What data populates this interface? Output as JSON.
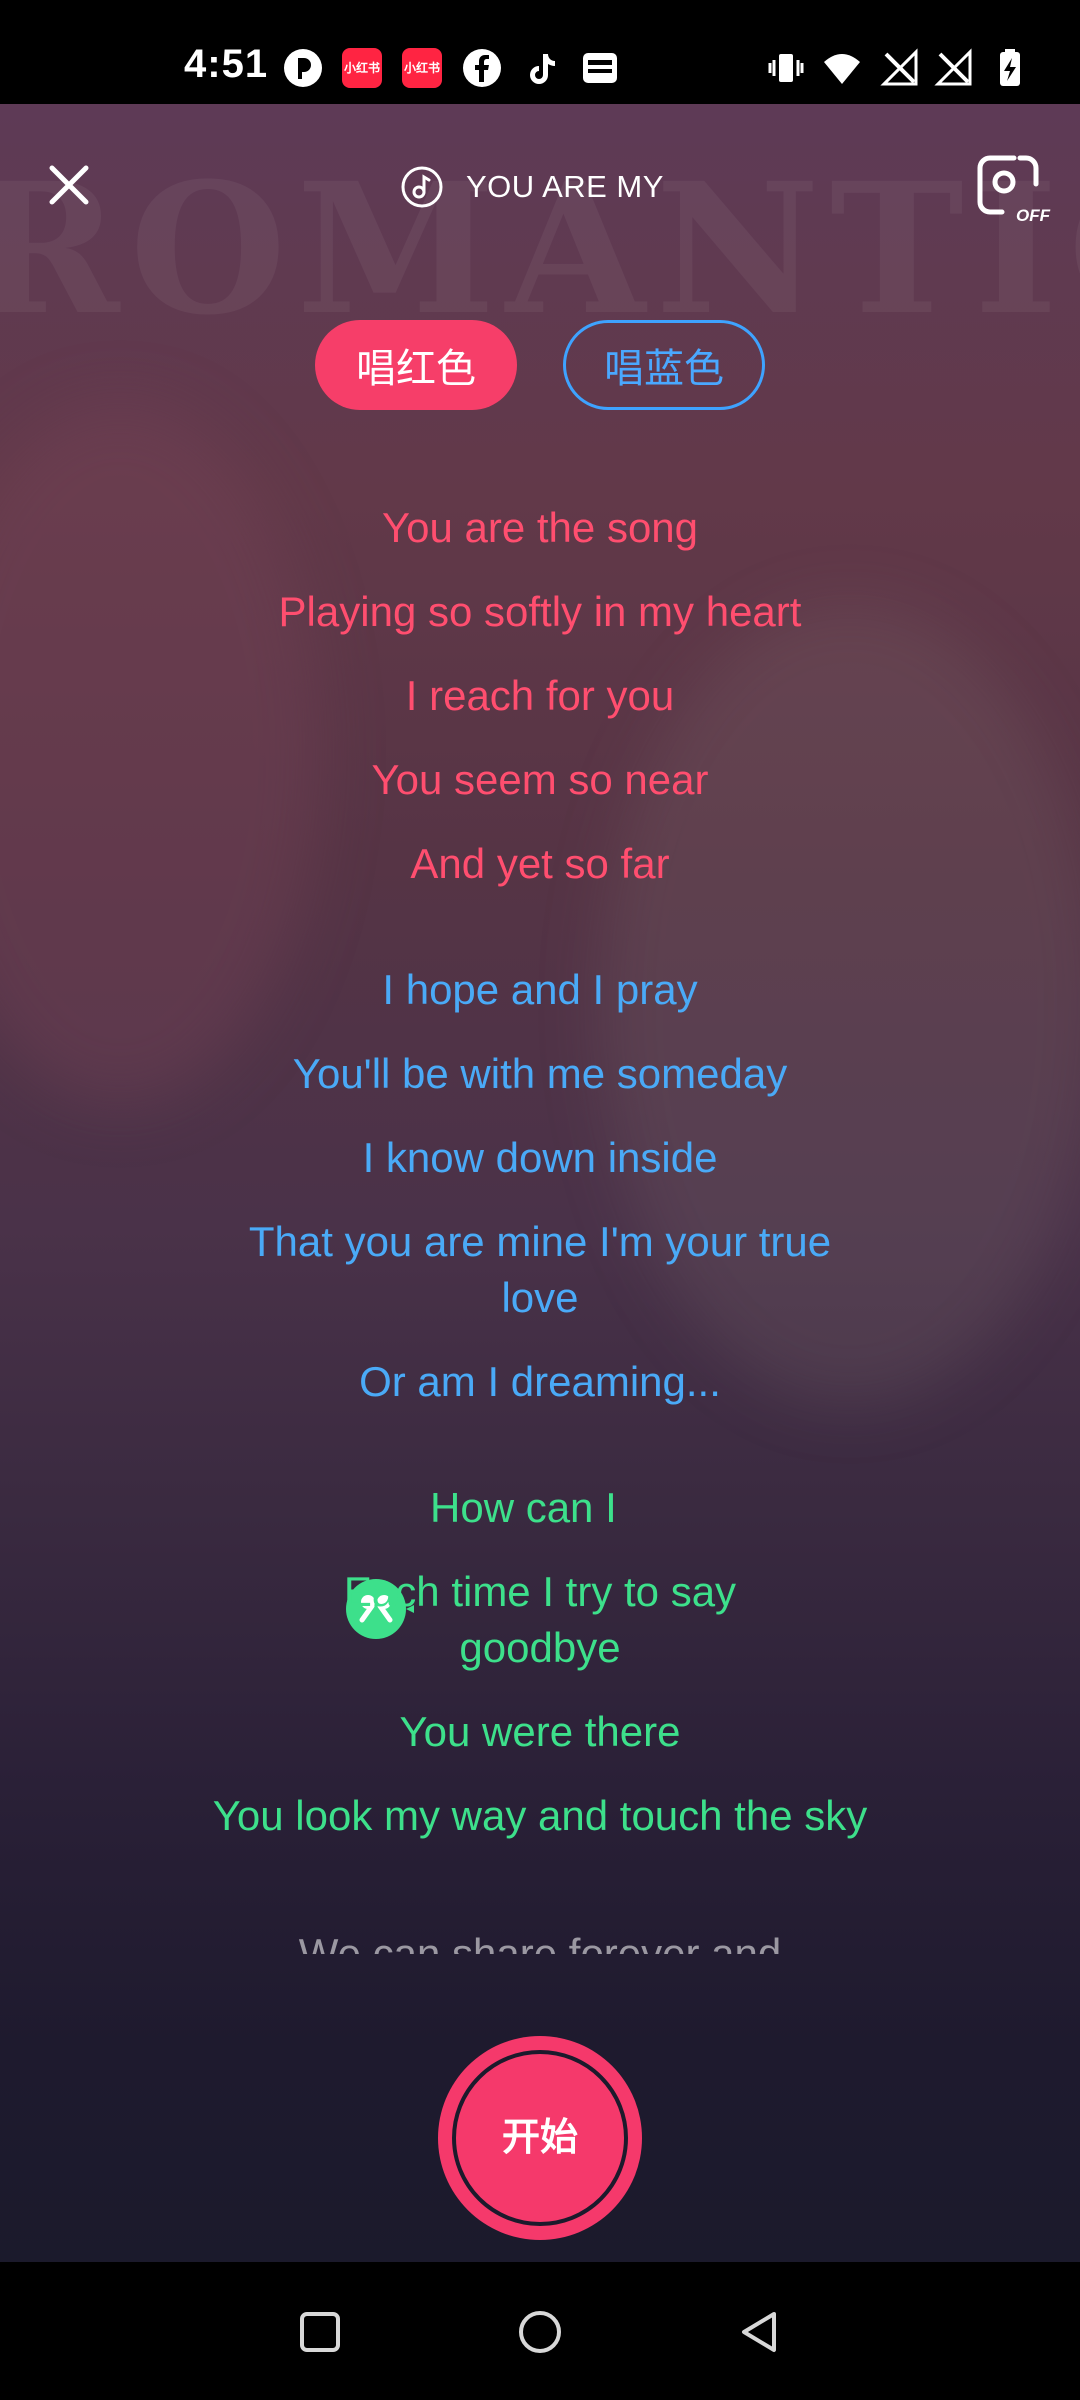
{
  "status_bar": {
    "time": "4:51",
    "notification_icons": [
      "tiktok-alt-icon",
      "xiaohongshu-icon",
      "xiaohongshu-icon",
      "facebook-icon",
      "tiktok-icon",
      "wallet-icon"
    ],
    "xhs_label": "小红书",
    "system_icons": [
      "vibrate-icon",
      "wifi-icon",
      "no-signal-icon",
      "no-signal-icon",
      "battery-charging-icon"
    ]
  },
  "header": {
    "song_title": "YOU ARE MY",
    "camera_state": "OFF"
  },
  "part_selector": {
    "red_label": "唱红色",
    "blue_label": "唱蓝色"
  },
  "lyrics": [
    {
      "text": "You are the song",
      "color": "red"
    },
    {
      "text": "Playing so softly in my heart",
      "color": "red"
    },
    {
      "text": "I reach for you",
      "color": "red"
    },
    {
      "text": "You seem so near",
      "color": "red"
    },
    {
      "text": "And yet so far",
      "color": "red"
    },
    {
      "text": "I hope and I pray",
      "color": "blue"
    },
    {
      "text": "You'll be with me someday",
      "color": "blue"
    },
    {
      "text": "I know down inside",
      "color": "blue"
    },
    {
      "text": "That you are mine I'm your true love",
      "color": "blue"
    },
    {
      "text": "Or am I dreaming...",
      "color": "blue"
    },
    {
      "text": "How can I",
      "color": "green"
    },
    {
      "text": "Each time I try to say goodbye",
      "color": "green"
    },
    {
      "text": "You were there",
      "color": "green"
    },
    {
      "text": "You look my way and touch the sky",
      "color": "green"
    },
    {
      "text": "We can share forever and",
      "color": "faded"
    }
  ],
  "start_button": {
    "label": "开始"
  },
  "colors": {
    "red_part": "#ff4e6f",
    "blue_part": "#4aaaf7",
    "duet_part": "#3de08b",
    "accent": "#f5396b"
  }
}
